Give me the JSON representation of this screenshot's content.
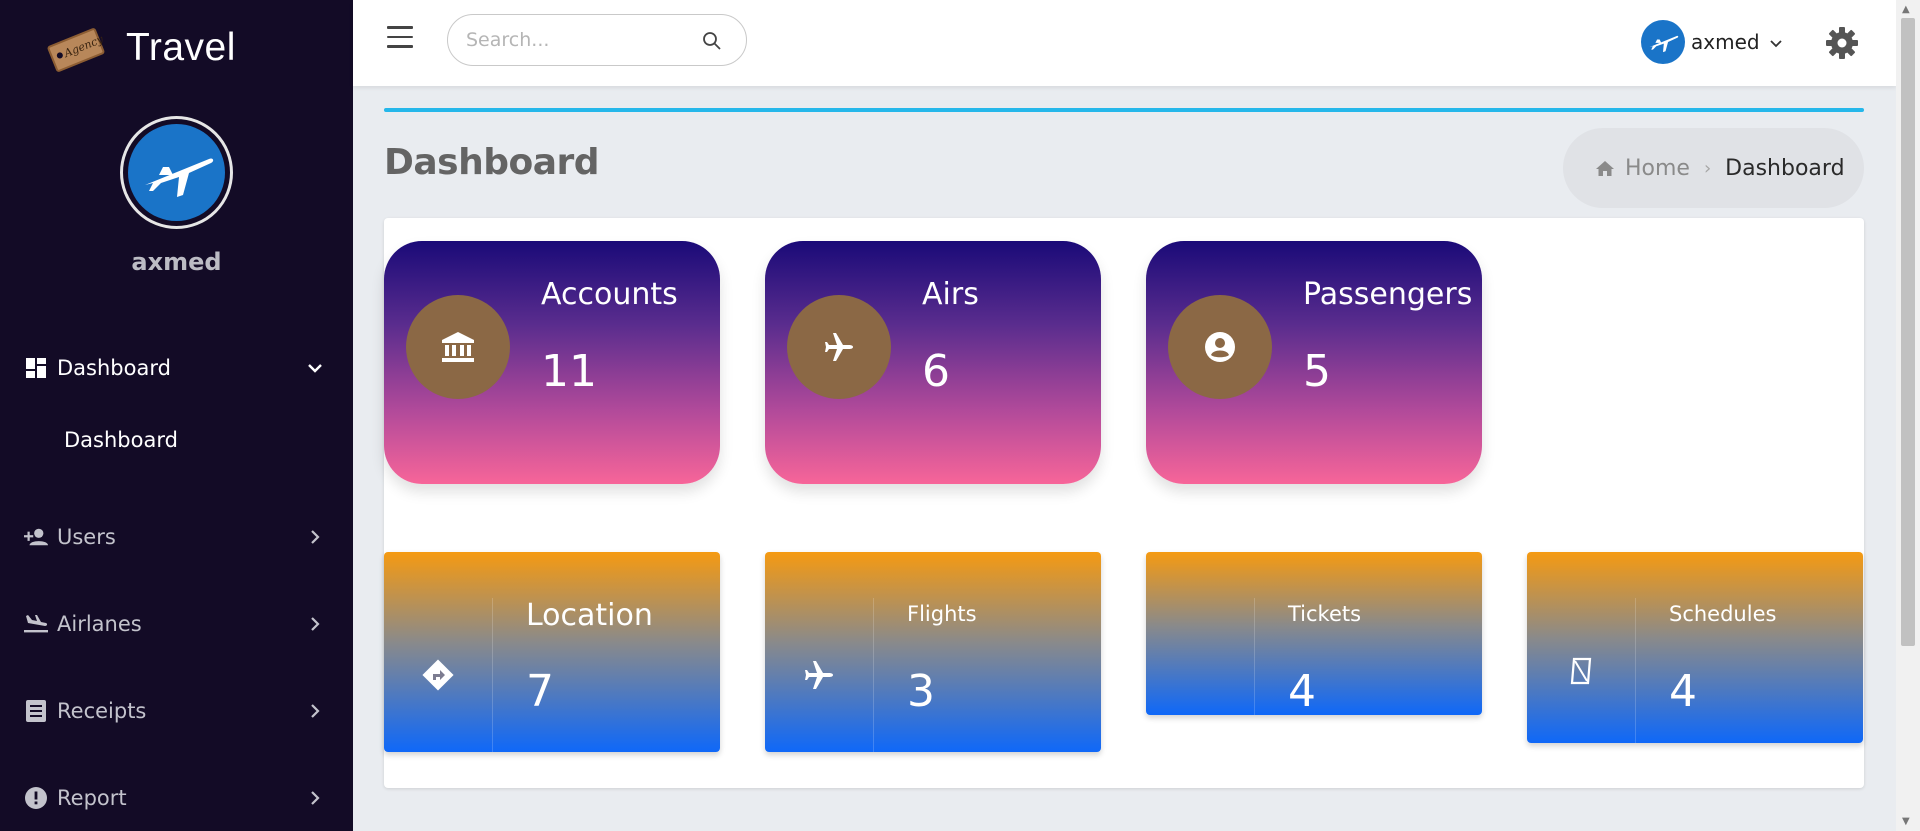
{
  "brand": {
    "title": "Travel",
    "logo_text": "Agency"
  },
  "profile": {
    "name": "axmed"
  },
  "sidebar": {
    "items": [
      {
        "label": "Dashboard",
        "icon": "dashboard-icon",
        "expanded": true,
        "sub_items": [
          "Dashboard"
        ]
      },
      {
        "label": "Users",
        "icon": "user-plus-icon"
      },
      {
        "label": "Airlanes",
        "icon": "flight-land-icon"
      },
      {
        "label": "Receipts",
        "icon": "receipt-icon"
      },
      {
        "label": "Report",
        "icon": "alert-circle-icon"
      }
    ]
  },
  "topbar": {
    "search_placeholder": "Search...",
    "user_name": "axmed"
  },
  "page": {
    "title": "Dashboard",
    "breadcrumb": {
      "home": "Home",
      "current": "Dashboard"
    }
  },
  "stat_cards": [
    {
      "title": "Accounts",
      "value": "11",
      "icon": "bank-icon"
    },
    {
      "title": "Airs",
      "value": "6",
      "icon": "airplane-icon"
    },
    {
      "title": "Passengers",
      "value": "5",
      "icon": "user-circle-icon"
    }
  ],
  "info_cards": [
    {
      "title": "Location",
      "value": "7",
      "icon": "directions-icon"
    },
    {
      "title": "Flights",
      "value": "3",
      "icon": "airplane-icon"
    },
    {
      "title": "Tickets",
      "value": "4",
      "icon": "ticket-icon"
    },
    {
      "title": "Schedules",
      "value": "4",
      "icon": "hourglass-icon"
    }
  ],
  "colors": {
    "sidebar_bg": "#130b26",
    "accent_line": "#25b7ea",
    "avatar_blue": "#1a74c8",
    "stat_gradient_top": "#1a0a78",
    "stat_gradient_bottom": "#f76599",
    "info_gradient_top": "#f59a12",
    "info_gradient_bottom": "#0f68f8",
    "stat_icon_circle": "#8b6845"
  }
}
